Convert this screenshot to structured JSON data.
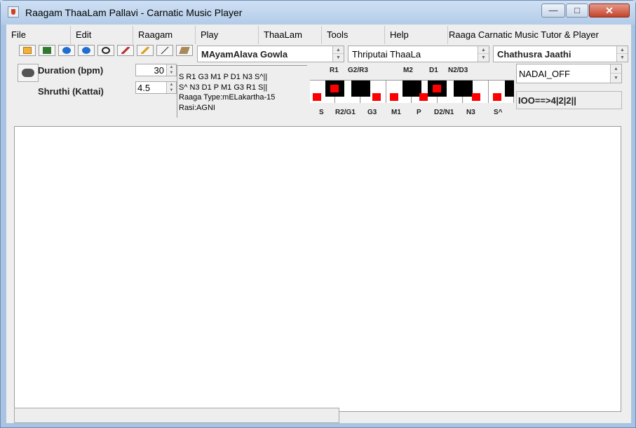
{
  "window": {
    "title": "Raagam ThaaLam Pallavi - Carnatic Music Player",
    "controls": {
      "minimize": "—",
      "maximize": "□",
      "close": "✕"
    }
  },
  "menubar": {
    "items": [
      "File",
      "Edit",
      "Raagam",
      "Play",
      "ThaaLam",
      "Tools",
      "Help",
      "Raaga Carnatic Music Tutor & Player"
    ]
  },
  "toolbar": {
    "icons": [
      "open-folder-icon",
      "music-file-icon",
      "play-icon",
      "pause-icon",
      "stop-icon",
      "brush-icon",
      "pencil-icon",
      "line-icon",
      "eraser-icon"
    ]
  },
  "selectors": {
    "raagam": "MAyamAlava Gowla",
    "thaalam": "Thriputai ThaaLa",
    "jaathi": "Chathusra Jaathi"
  },
  "controls": {
    "duration_label": "Duration (bpm)",
    "duration_value": "30",
    "shruthi_label": "Shruthi (Kattai)",
    "shruthi_value": "4.5"
  },
  "raaga_info": {
    "arohanam": "S R1 G3 M1 P D1 N3 S^||",
    "avarohanam": "S^ N3 D1 P M1 G3 R1 S||",
    "type": "Raaga Type:mELakartha-15",
    "rasi": "Rasi:AGNI"
  },
  "keyboard": {
    "top_labels": [
      "R1",
      "G2/R3",
      "M2",
      "D1",
      "N2/D3"
    ],
    "bottom_labels": [
      "S",
      "R2/G1",
      "G3",
      "M1",
      "P",
      "D2/N1",
      "N3",
      "S^"
    ],
    "highlight_color": "#ff0000"
  },
  "nadai": {
    "value": "NADAI_OFF"
  },
  "pattern": {
    "value": "IOO==>4|2|2||"
  }
}
